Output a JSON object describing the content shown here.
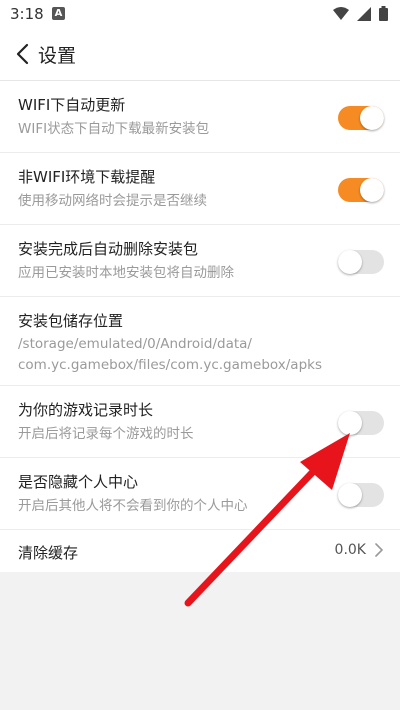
{
  "status_bar": {
    "time": "3:18",
    "notification_glyph": "A",
    "icons": [
      "wifi-icon",
      "signal-icon",
      "battery-icon"
    ]
  },
  "header": {
    "title": "设置",
    "back_icon": "chevron-left-icon"
  },
  "settings": [
    {
      "title": "WIFI下自动更新",
      "subtitle": "WIFI状态下自动下载最新安装包",
      "toggle": "on"
    },
    {
      "title": "非WIFI环境下载提醒",
      "subtitle": "使用移动网络时会提示是否继续",
      "toggle": "on"
    },
    {
      "title": "安装完成后自动删除安装包",
      "subtitle": "应用已安装时本地安装包将自动删除",
      "toggle": "off"
    },
    {
      "title": "安装包储存位置",
      "path_line1": "/storage/emulated/0/Android/data/",
      "path_line2": "com.yc.gamebox/files/com.yc.gamebox/apks"
    },
    {
      "title": "为你的游戏记录时长",
      "subtitle": "开启后将记录每个游戏的时长",
      "toggle": "off"
    },
    {
      "title": "是否隐藏个人中心",
      "subtitle": "开启后其他人将不会看到你的个人中心",
      "toggle": "off"
    },
    {
      "title": "清除缓存",
      "value": "0.0K"
    }
  ],
  "colors": {
    "accent": "#f58b22",
    "toggle_off": "#e3e3e3",
    "annotation_arrow": "#e8141b"
  }
}
